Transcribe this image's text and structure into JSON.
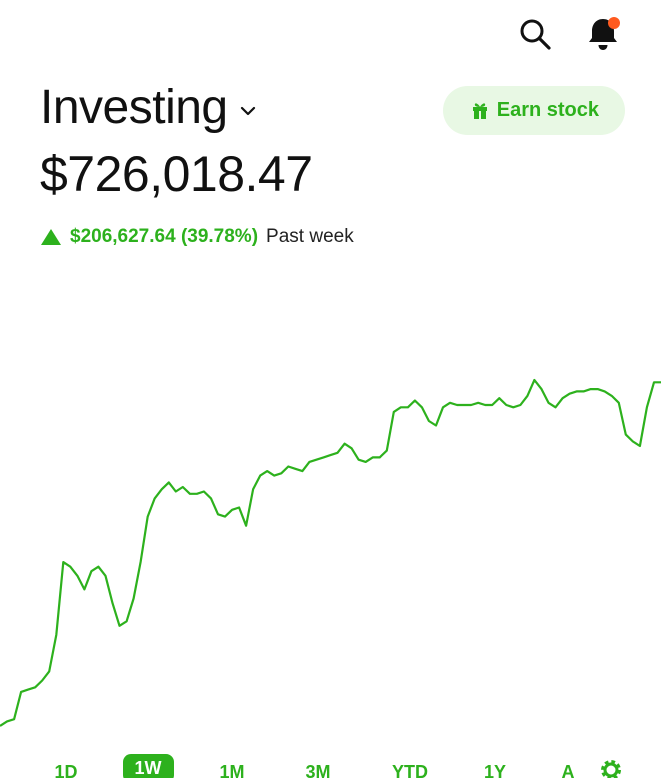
{
  "header": {
    "title": "Investing",
    "earn_button_label": "Earn stock",
    "balance": "$726,018.47",
    "change_value": "$206,627.64 (39.78%)",
    "change_period": "Past week"
  },
  "icons": {
    "search": "search-icon",
    "bell": "bell-icon",
    "gift": "gift-icon",
    "chevron": "chevron-down-icon",
    "settings": "gear-icon"
  },
  "colors": {
    "accent": "#2db11d",
    "accent_bg": "#e8f8e4",
    "notification": "#ff5a1f"
  },
  "tabs": [
    {
      "label": "1D",
      "active": false
    },
    {
      "label": "1W",
      "active": true
    },
    {
      "label": "1M",
      "active": false
    },
    {
      "label": "3M",
      "active": false
    },
    {
      "label": "YTD",
      "active": false
    },
    {
      "label": "1Y",
      "active": false
    },
    {
      "label": "A",
      "active": false
    }
  ],
  "chart_data": {
    "type": "line",
    "title": "",
    "xlabel": "",
    "ylabel": "",
    "grid": false,
    "series": [
      {
        "values": [
          0,
          2,
          3,
          15,
          16,
          17,
          20,
          24,
          40,
          72,
          70,
          66,
          60,
          68,
          70,
          66,
          54,
          44,
          46,
          56,
          72,
          92,
          100,
          104,
          107,
          103,
          105,
          102,
          102,
          103,
          100,
          93,
          92,
          95,
          96,
          88,
          104,
          110,
          112,
          110,
          111,
          114,
          113,
          112,
          116,
          117,
          118,
          119,
          120,
          124,
          122,
          117,
          116,
          118,
          118,
          121,
          138,
          140,
          140,
          143,
          140,
          134,
          132,
          140,
          142,
          141,
          141,
          141,
          142,
          141,
          141,
          144,
          141,
          140,
          141,
          145,
          152,
          148,
          142,
          140,
          144,
          146,
          147,
          147,
          148,
          148,
          147,
          145,
          142,
          128,
          125,
          123,
          140,
          151,
          151
        ]
      }
    ]
  }
}
